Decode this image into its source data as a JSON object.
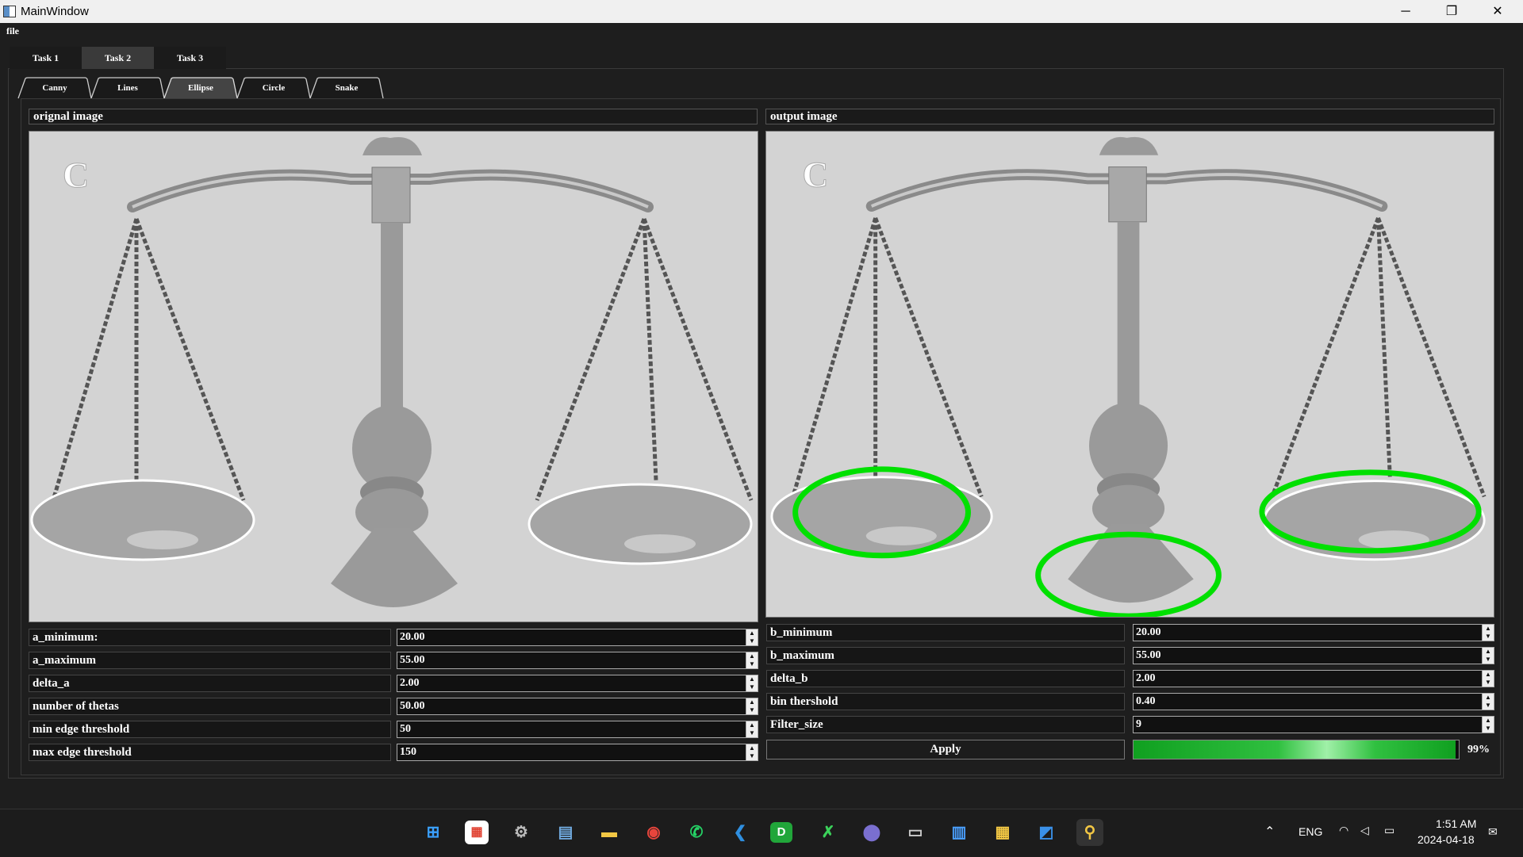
{
  "window": {
    "title": "MainWindow",
    "minimize": "─",
    "maximize": "❐",
    "close": "✕"
  },
  "menu": {
    "file": "file"
  },
  "tabs": [
    {
      "label": "Task 1"
    },
    {
      "label": "Task 2"
    },
    {
      "label": "Task 3"
    }
  ],
  "active_tab": "Task 2",
  "subtabs": [
    {
      "label": "Canny"
    },
    {
      "label": "Lines"
    },
    {
      "label": "Ellipse"
    },
    {
      "label": "Circle"
    },
    {
      "label": "Snake"
    }
  ],
  "active_subtab": "Ellipse",
  "original_image": {
    "label": "orignal image",
    "watermark": "C"
  },
  "output_image": {
    "label": "output image",
    "watermark": "C"
  },
  "left_params": [
    {
      "label": "a_minimum:",
      "value": "20.00"
    },
    {
      "label": "a_maximum",
      "value": "55.00"
    },
    {
      "label": "delta_a",
      "value": "2.00"
    },
    {
      "label": "number of thetas",
      "value": "50.00"
    },
    {
      "label": "min edge threshold",
      "value": "50"
    },
    {
      "label": "max edge threshold",
      "value": "150"
    }
  ],
  "right_params": [
    {
      "label": "b_minimum",
      "value": "20.00"
    },
    {
      "label": "b_maximum",
      "value": "55.00"
    },
    {
      "label": "delta_b",
      "value": "2.00"
    },
    {
      "label": "bin thershold",
      "value": "0.40"
    },
    {
      "label": "Filter_size",
      "value": "9"
    }
  ],
  "apply_button": {
    "label": "Apply"
  },
  "progress": {
    "value": 0.99,
    "text": "99%"
  },
  "colors": {
    "accent_green": "#00e000",
    "panel": "#1e1e1e",
    "image_bg": "#d3d3d3"
  },
  "taskbar": {
    "icons": [
      "windows-start-icon",
      "microsoft-store-icon",
      "settings-icon",
      "keyboard-app-icon",
      "file-explorer-icon",
      "chrome-icon",
      "whatsapp-icon",
      "vscode-icon",
      "d-app-icon",
      "x-app-icon",
      "eclipse-icon",
      "terminal-icon",
      "notepad-icon",
      "archive-icon",
      "paint-icon",
      "python-icon"
    ],
    "language": "ENG",
    "time": "1:51 AM",
    "date": "2024-04-18"
  }
}
